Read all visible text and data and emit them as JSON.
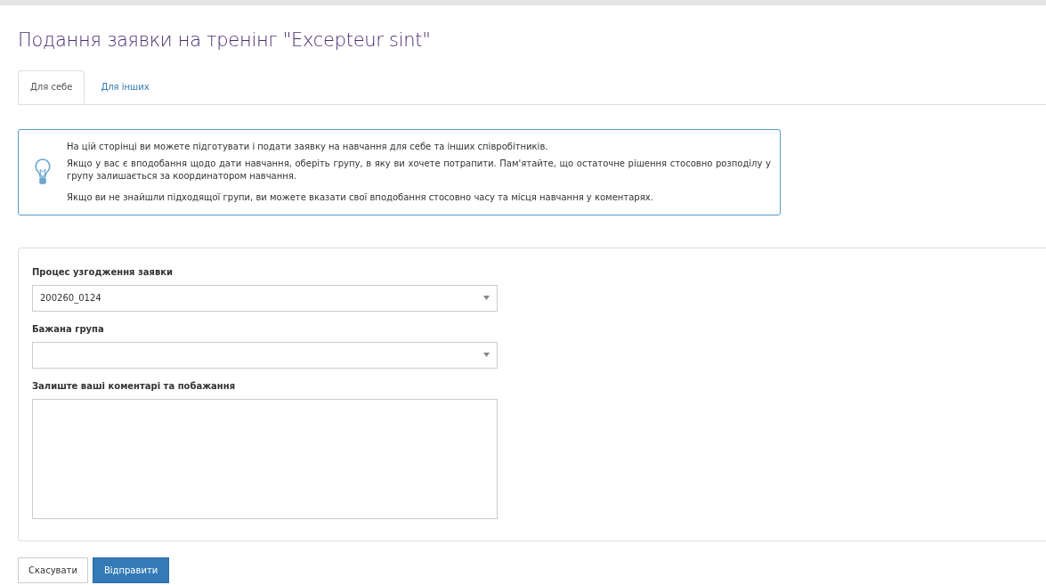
{
  "title": "Подання заявки на тренінг \"Excepteur sint\"",
  "tabs": [
    {
      "label": "Для себе",
      "selected": true
    },
    {
      "label": "Для інших",
      "selected": false
    }
  ],
  "info": [
    "На цій сторінці ви можете підготувати і подати заявку на навчання для себе та інших співробітників.",
    "Якщо у вас є вподобання щодо дати навчання, оберіть групу, в яку ви хочете потрапити. Пам'ятайте, що остаточне рішення стосовно розподілу у групу залишається за координатором навчання.",
    "Якщо ви не знайшли підходящої групи, ви можете вказати свої вподобання стосовно часу та місця навчання у коментарях."
  ],
  "fields": [
    {
      "kind": "select",
      "label": "Процес узгодження заявки",
      "value": "200260_0124"
    },
    {
      "kind": "select",
      "label": "Бажана група"
    },
    {
      "kind": "textarea",
      "label": "Залиште ваші коментарі та побажання"
    }
  ],
  "buttons": [
    {
      "label": "Скасувати",
      "kind": "secondary"
    },
    {
      "label": "Відправити",
      "kind": "primary"
    }
  ]
}
